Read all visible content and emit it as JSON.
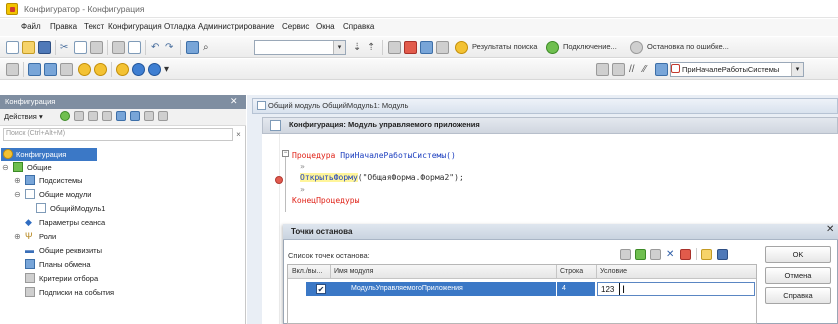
{
  "window": {
    "title": "Конфигуратор - Конфигурация"
  },
  "menu": [
    "Файл",
    "Правка",
    "Текст",
    "Конфигурация",
    "Отладка",
    "Администрирование",
    "Сервис",
    "Окна",
    "Справка"
  ],
  "toolbar": {
    "search_results_label": "Результаты поиска",
    "connection_label": "Подключение...",
    "stop_on_error_label": "Остановка по ошибке...",
    "procedure_value": "ПриНачалеРаботыСистемы"
  },
  "left_panel": {
    "title": "Конфигурация",
    "actions_label": "Действия ▾",
    "search_placeholder": "Поиск (Ctrl+Alt+M)",
    "tree": [
      {
        "label": "Конфигурация",
        "selected": true
      },
      {
        "label": "Общие"
      },
      {
        "label": "Подсистемы"
      },
      {
        "label": "Общие модули"
      },
      {
        "label": "ОбщийМодуль1"
      },
      {
        "label": "Параметры сеанса"
      },
      {
        "label": "Роли"
      },
      {
        "label": "Общие реквизиты"
      },
      {
        "label": "Планы обмена"
      },
      {
        "label": "Критерии отбора"
      },
      {
        "label": "Подписки на события"
      }
    ]
  },
  "editor": {
    "tab_title": "Общий модуль ОбщийМодуль1: Модуль",
    "module_header": "Конфигурация: Модуль управляемого приложения",
    "code": {
      "line1_kw": "Процедура",
      "line1_name": "ПриНачалеРаботыСистемы",
      "line1_parens": "()",
      "dot": "»",
      "call_name": "ОткрытьФорму",
      "call_args": "(\"ОбщаяФорма.Форма2\");",
      "end_kw": "КонецПроцедуры"
    }
  },
  "breakpoints_dialog": {
    "title": "Точки останова",
    "list_label": "Список точек останова:",
    "columns": [
      "Вкл./вы...",
      "Имя модуля",
      "Строка",
      "Условие"
    ],
    "row": {
      "enabled": true,
      "module": "МодульУправляемогоПриложения",
      "line": "4",
      "condition": "123"
    },
    "buttons": {
      "ok": "OK",
      "cancel": "Отмена",
      "help": "Справка"
    }
  },
  "icons": [
    "app-icon",
    "new-doc-icon",
    "open-folder-icon",
    "save-icon",
    "cut-icon",
    "copy-icon",
    "paste-icon",
    "undo-icon",
    "redo-icon",
    "find-icon",
    "search-results-icon",
    "connection-icon",
    "stop-on-error-icon",
    "breakpoint-icon",
    "close-icon"
  ]
}
